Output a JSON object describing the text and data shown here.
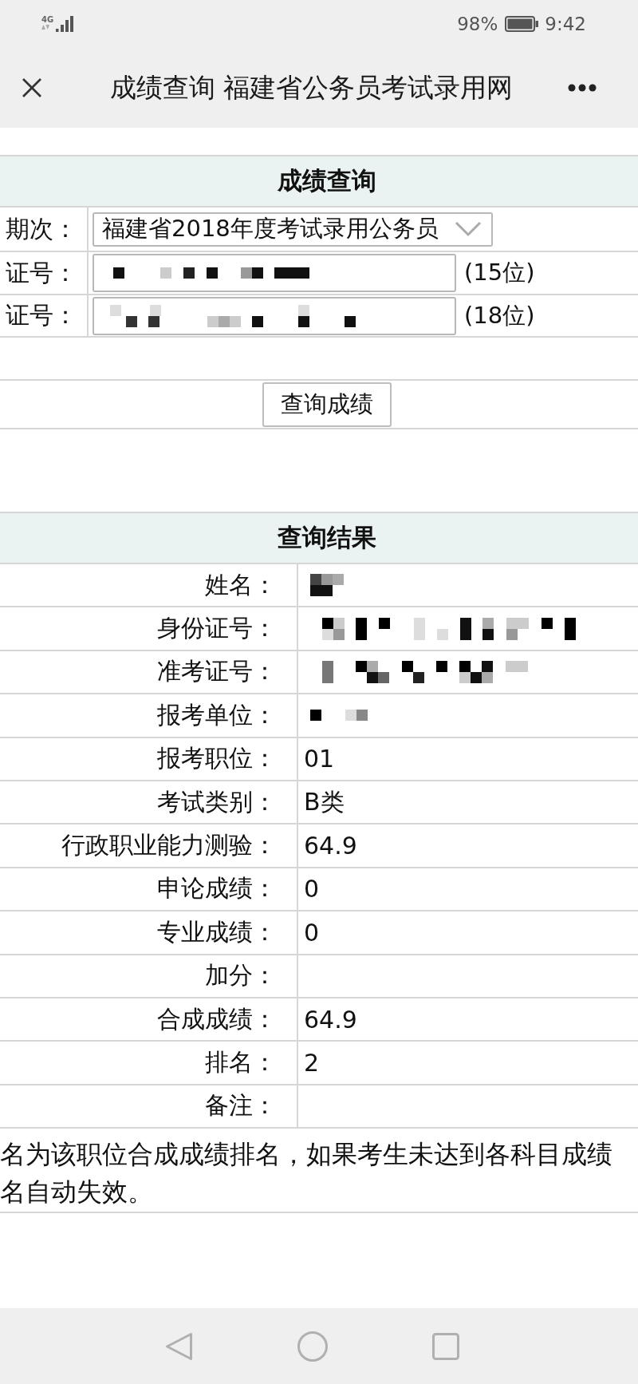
{
  "status_bar": {
    "network": "4G",
    "battery": "98%",
    "time": "9:42"
  },
  "title_bar": {
    "title": "成绩查询 福建省公务员考试录用网"
  },
  "query_form": {
    "heading": "成绩查询",
    "fields": [
      {
        "kind": "select",
        "label": "期次：",
        "value": "福建省2018年度考试录用公务员",
        "redacted": false
      },
      {
        "kind": "input",
        "label": "证号：",
        "redacted": true,
        "suffix": "(15位)"
      },
      {
        "kind": "input",
        "label": "证号：",
        "redacted": true,
        "suffix": "(18位)"
      }
    ],
    "button": "查询成绩"
  },
  "results": {
    "heading": "查询结果",
    "rows": [
      {
        "label": "姓名：",
        "redacted": true
      },
      {
        "label": "身份证号：",
        "redacted": true
      },
      {
        "label": "准考证号：",
        "redacted": true
      },
      {
        "label": "报考单位：",
        "redacted": true
      },
      {
        "label": "报考职位：",
        "value": "01",
        "redacted": false
      },
      {
        "label": "考试类别：",
        "value": "B类",
        "redacted": false
      },
      {
        "label": "行政职业能力测验：",
        "value": "64.9",
        "redacted": false
      },
      {
        "label": "申论成绩：",
        "value": "0",
        "redacted": false
      },
      {
        "label": "专业成绩：",
        "value": "0",
        "redacted": false
      },
      {
        "label": "加分：",
        "redacted": false
      },
      {
        "label": "合成成绩：",
        "value": "64.9",
        "redacted": false
      },
      {
        "label": "排名：",
        "value": "2",
        "redacted": false
      },
      {
        "label": "备注：",
        "redacted": false
      }
    ],
    "note_lines": [
      "名为该职位合成成绩排名，如果考生未达到各科目成绩",
      "名自动失效。"
    ]
  }
}
